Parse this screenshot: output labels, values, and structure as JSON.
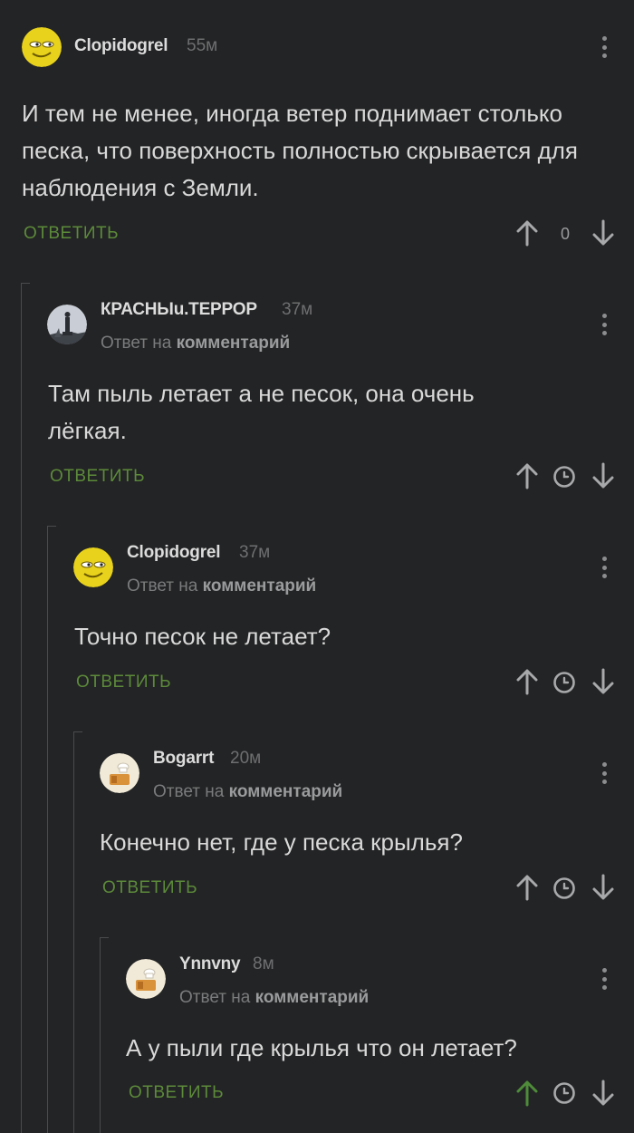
{
  "comments": [
    {
      "author": "Clopidogrel",
      "time": "55м",
      "reply_prefix": "",
      "reply_target": "",
      "text": "И тем не менее, иногда ветер поднимает столько песка, что поверхность полностью скрывается для наблюдения с Земли.",
      "reply_label": "ОТВЕТИТЬ",
      "score": "0",
      "avatar": "yellow-face-icon",
      "upvoted": false
    },
    {
      "author": "КРАСНЫu.ТЕРРОР",
      "time": "37м",
      "reply_prefix": "Ответ на",
      "reply_target": "комментарий",
      "text": "Там пыль летает а не песок, она очень лёгкая.",
      "reply_label": "ОТВЕТИТЬ",
      "avatar": "monument-photo-icon",
      "upvoted": false
    },
    {
      "author": "Clopidogrel",
      "time": "37м",
      "reply_prefix": "Ответ на",
      "reply_target": "комментарий",
      "text": "Точно песок не летает?",
      "reply_label": "ОТВЕТИТЬ",
      "avatar": "yellow-face-icon",
      "upvoted": false
    },
    {
      "author": "Bogarrt",
      "time": "20м",
      "reply_prefix": "Ответ на",
      "reply_target": "комментарий",
      "text": "Конечно нет, где у песка крылья?",
      "reply_label": "ОТВЕТИТЬ",
      "avatar": "chef-avatar-icon",
      "upvoted": false
    },
    {
      "author": "Ynnvny",
      "time": "8м",
      "reply_prefix": "Ответ на",
      "reply_target": "комментарий",
      "text": "А у пыли где крылья что он летает?",
      "reply_label": "ОТВЕТИТЬ",
      "avatar": "chef-avatar-icon",
      "upvoted": true
    }
  ],
  "colors": {
    "background": "#232425",
    "reply_green": "#5c8a3a",
    "upvote_active": "#4e8c3a",
    "icon_gray": "#a8a9aa"
  }
}
